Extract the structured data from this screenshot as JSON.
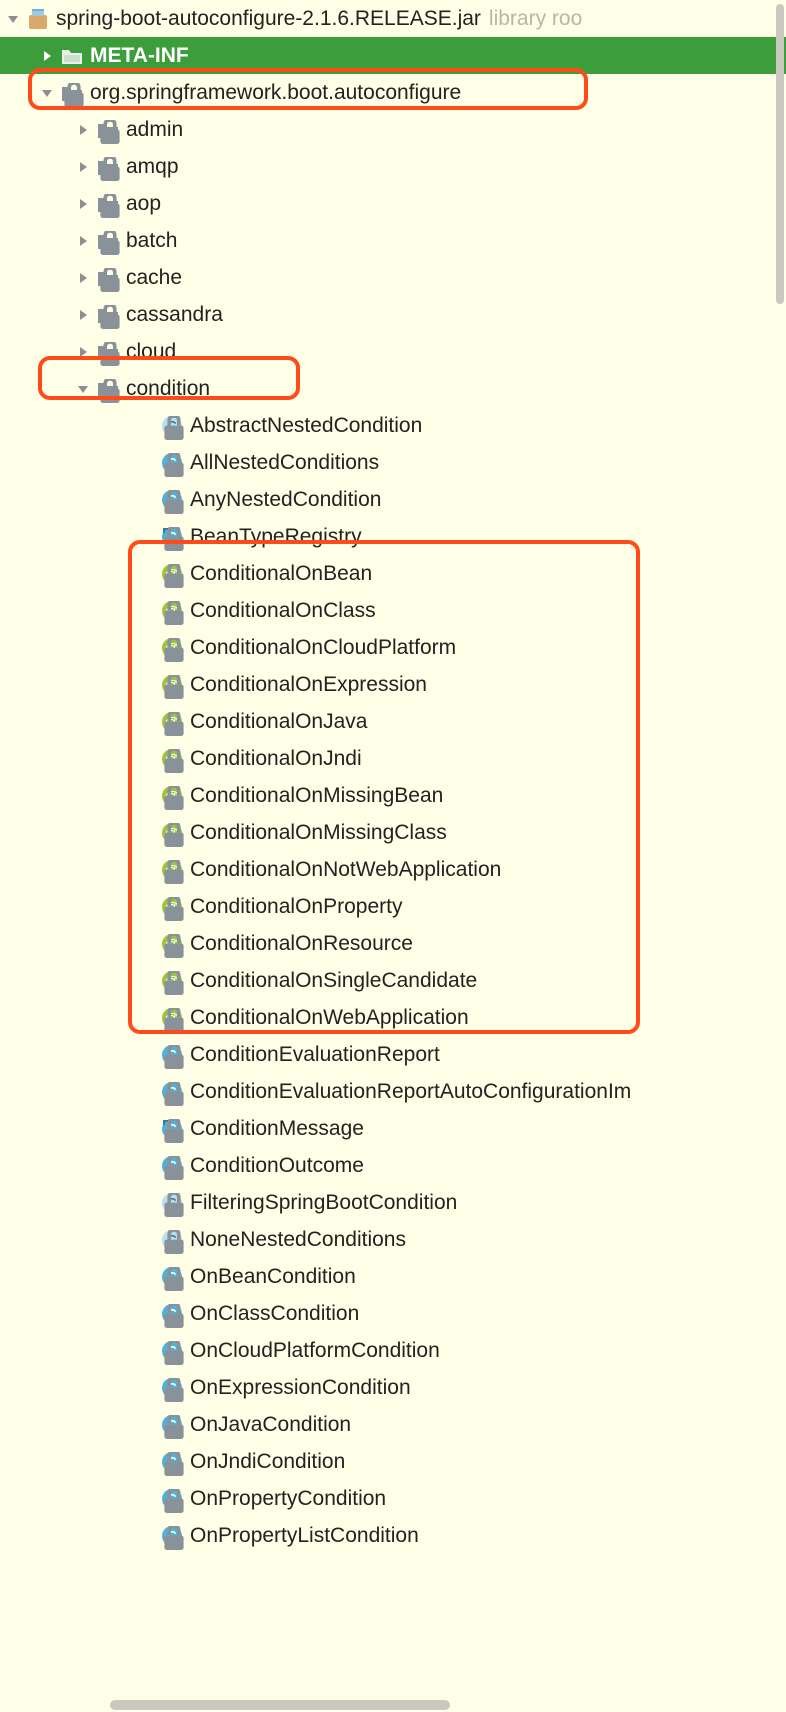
{
  "root": {
    "jar_name": "spring-boot-autoconfigure-2.1.6.RELEASE.jar",
    "jar_suffix": "library roo"
  },
  "tree": {
    "meta_inf": "META-INF",
    "pkg": "org.springframework.boot.autoconfigure",
    "packages": [
      "admin",
      "amqp",
      "aop",
      "batch",
      "cache",
      "cassandra",
      "cloud"
    ],
    "condition_pkg": "condition",
    "condition_classes_top": [
      {
        "name": "AbstractNestedCondition",
        "type": "class-abstract"
      },
      {
        "name": "AllNestedConditions",
        "type": "class"
      },
      {
        "name": "AnyNestedCondition",
        "type": "class"
      },
      {
        "name": "BeanTypeRegistry",
        "type": "class-final"
      }
    ],
    "condition_annotations": [
      "ConditionalOnBean",
      "ConditionalOnClass",
      "ConditionalOnCloudPlatform",
      "ConditionalOnExpression",
      "ConditionalOnJava",
      "ConditionalOnJndi",
      "ConditionalOnMissingBean",
      "ConditionalOnMissingClass",
      "ConditionalOnNotWebApplication",
      "ConditionalOnProperty",
      "ConditionalOnResource",
      "ConditionalOnSingleCandidate",
      "ConditionalOnWebApplication"
    ],
    "condition_classes_bottom": [
      {
        "name": "ConditionEvaluationReport",
        "type": "class"
      },
      {
        "name": "ConditionEvaluationReportAutoConfigurationIm",
        "type": "class"
      },
      {
        "name": "ConditionMessage",
        "type": "class-final"
      },
      {
        "name": "ConditionOutcome",
        "type": "class"
      },
      {
        "name": "FilteringSpringBootCondition",
        "type": "class-abstract"
      },
      {
        "name": "NoneNestedConditions",
        "type": "class-abstract"
      },
      {
        "name": "OnBeanCondition",
        "type": "class"
      },
      {
        "name": "OnClassCondition",
        "type": "class"
      },
      {
        "name": "OnCloudPlatformCondition",
        "type": "class"
      },
      {
        "name": "OnExpressionCondition",
        "type": "class"
      },
      {
        "name": "OnJavaCondition",
        "type": "class"
      },
      {
        "name": "OnJndiCondition",
        "type": "class"
      },
      {
        "name": "OnPropertyCondition",
        "type": "class"
      },
      {
        "name": "OnPropertyListCondition",
        "type": "class"
      }
    ]
  }
}
